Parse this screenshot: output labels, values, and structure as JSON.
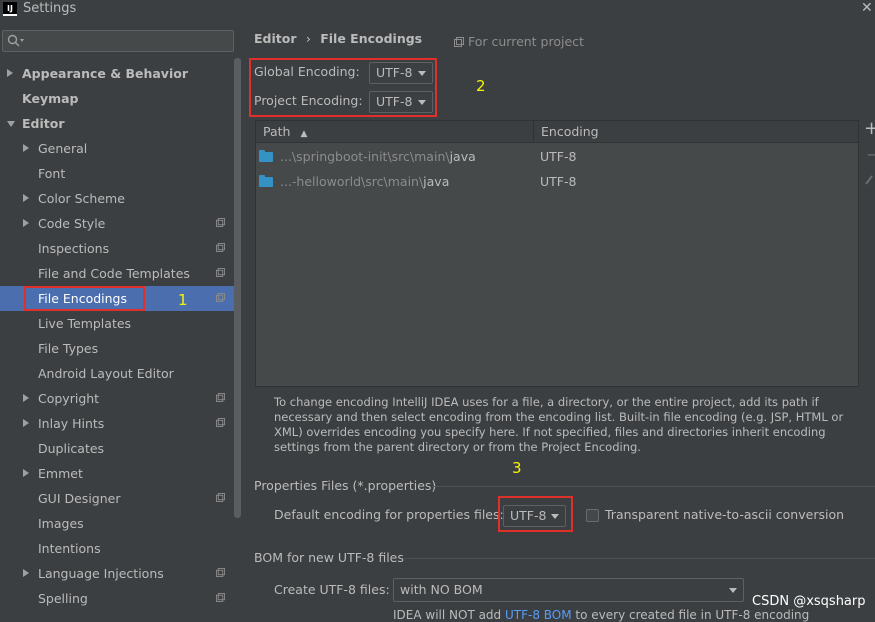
{
  "window": {
    "title": "Settings",
    "icon": "IJ"
  },
  "sidebar": {
    "items": [
      {
        "label": "Appearance & Behavior",
        "level": 0,
        "arrow": "right",
        "bold": true,
        "copy": false
      },
      {
        "label": "Keymap",
        "level": 0,
        "arrow": "none",
        "bold": true,
        "copy": false
      },
      {
        "label": "Editor",
        "level": 0,
        "arrow": "down",
        "bold": true,
        "copy": false
      },
      {
        "label": "General",
        "level": 1,
        "arrow": "right",
        "bold": false,
        "copy": false
      },
      {
        "label": "Font",
        "level": 1,
        "arrow": "none",
        "bold": false,
        "copy": false
      },
      {
        "label": "Color Scheme",
        "level": 1,
        "arrow": "right",
        "bold": false,
        "copy": false
      },
      {
        "label": "Code Style",
        "level": 1,
        "arrow": "right",
        "bold": false,
        "copy": true
      },
      {
        "label": "Inspections",
        "level": 1,
        "arrow": "none",
        "bold": false,
        "copy": true
      },
      {
        "label": "File and Code Templates",
        "level": 1,
        "arrow": "none",
        "bold": false,
        "copy": true
      },
      {
        "label": "File Encodings",
        "level": 1,
        "arrow": "none",
        "bold": false,
        "copy": true,
        "selected": true
      },
      {
        "label": "Live Templates",
        "level": 1,
        "arrow": "none",
        "bold": false,
        "copy": false
      },
      {
        "label": "File Types",
        "level": 1,
        "arrow": "none",
        "bold": false,
        "copy": false
      },
      {
        "label": "Android Layout Editor",
        "level": 1,
        "arrow": "none",
        "bold": false,
        "copy": false
      },
      {
        "label": "Copyright",
        "level": 1,
        "arrow": "right",
        "bold": false,
        "copy": true
      },
      {
        "label": "Inlay Hints",
        "level": 1,
        "arrow": "right",
        "bold": false,
        "copy": true
      },
      {
        "label": "Duplicates",
        "level": 1,
        "arrow": "none",
        "bold": false,
        "copy": false
      },
      {
        "label": "Emmet",
        "level": 1,
        "arrow": "right",
        "bold": false,
        "copy": false
      },
      {
        "label": "GUI Designer",
        "level": 1,
        "arrow": "none",
        "bold": false,
        "copy": true
      },
      {
        "label": "Images",
        "level": 1,
        "arrow": "none",
        "bold": false,
        "copy": false
      },
      {
        "label": "Intentions",
        "level": 1,
        "arrow": "none",
        "bold": false,
        "copy": false
      },
      {
        "label": "Language Injections",
        "level": 1,
        "arrow": "right",
        "bold": false,
        "copy": true
      },
      {
        "label": "Spelling",
        "level": 1,
        "arrow": "none",
        "bold": false,
        "copy": true
      }
    ]
  },
  "breadcrumb": {
    "parent": "Editor",
    "separator": "›",
    "current": "File Encodings"
  },
  "for_project": "For current project",
  "encodings": {
    "global_label": "Global Encoding:",
    "global_value": "UTF-8",
    "project_label": "Project Encoding:",
    "project_value": "UTF-8"
  },
  "table": {
    "col_path": "Path",
    "col_encoding": "Encoding",
    "rows": [
      {
        "path_prefix": "...\\springboot-init\\src\\main\\",
        "path_last": "java",
        "encoding": "UTF-8"
      },
      {
        "path_prefix": "...-helloworld\\src\\main\\",
        "path_last": "java",
        "encoding": "UTF-8"
      }
    ]
  },
  "description": "To change encoding IntelliJ IDEA uses for a file, a directory, or the entire project, add its path if necessary and then select encoding from the encoding list. Built-in file encoding (e.g. JSP, HTML or XML) overrides encoding you specify here. If not specified, files and directories inherit encoding settings from the parent directory or from the Project Encoding.",
  "properties": {
    "section": "Properties Files (*.properties)",
    "default_label": "Default encoding for properties files:",
    "default_value": "UTF-8",
    "transparent_label": "Transparent native-to-ascii conversion"
  },
  "bom": {
    "section": "BOM for new UTF-8 files",
    "create_label": "Create UTF-8 files:",
    "create_value": "with NO BOM",
    "note_prefix": "IDEA will NOT add ",
    "note_link": "UTF-8 BOM",
    "note_suffix": " to every created file in UTF-8 encoding"
  },
  "annotations": {
    "n1": "1",
    "n2": "2",
    "n3": "3"
  },
  "watermark": "CSDN @xsqsharp",
  "colors": {
    "selection": "#4b6eaf",
    "annotation_box": "#e0302b",
    "annotation_text": "#f5f500",
    "link": "#589df6"
  }
}
